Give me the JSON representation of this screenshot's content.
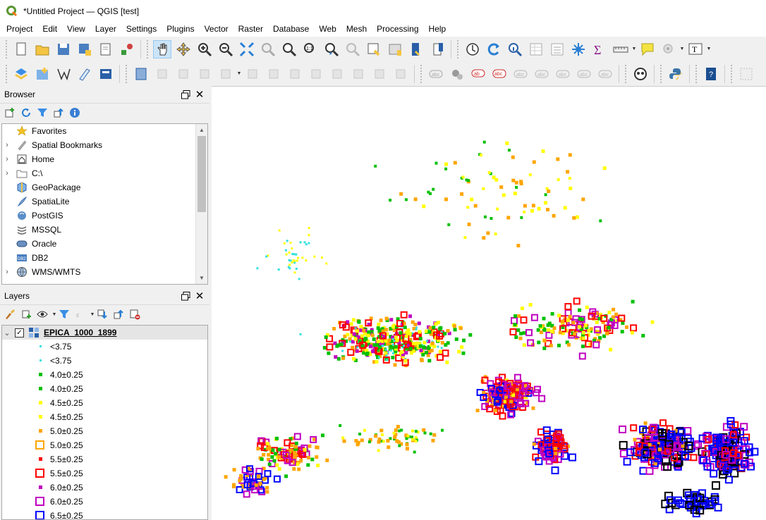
{
  "window": {
    "title": "*Untitled Project — QGIS [test]"
  },
  "menu": [
    "Project",
    "Edit",
    "View",
    "Layer",
    "Settings",
    "Plugins",
    "Vector",
    "Raster",
    "Database",
    "Web",
    "Mesh",
    "Processing",
    "Help"
  ],
  "toolbar1": [
    "new-project",
    "open-project",
    "save-project",
    "save-as",
    "print-layout",
    "style-manager",
    "pan",
    "pan-to-selection",
    "zoom-in",
    "zoom-out",
    "zoom-full",
    "zoom-to-selection",
    "zoom-to-layer",
    "zoom-native",
    "zoom-last",
    "zoom-next",
    "new-bookmark",
    "show-bookmarks",
    "temporal-controller",
    "refresh",
    "identify",
    "attribute-table",
    "field-calculator",
    "statistical-summary",
    "measure",
    "map-tips",
    "text-annotation"
  ],
  "toolbar2": [
    "data-source-manager",
    "new-geopackage-layer",
    "vertex-tool",
    "digitize",
    "save-edits",
    "add-feature",
    "label-tool",
    "pin-labels",
    "show-hide-labels",
    "python-console",
    "help"
  ],
  "browser": {
    "title": "Browser",
    "items": [
      {
        "label": "Favorites",
        "icon": "star-icon",
        "expandable": false
      },
      {
        "label": "Spatial Bookmarks",
        "icon": "bookmarks-icon",
        "expandable": true
      },
      {
        "label": "Home",
        "icon": "home-icon",
        "expandable": true
      },
      {
        "label": "C:\\",
        "icon": "folder-icon",
        "expandable": true
      },
      {
        "label": "GeoPackage",
        "icon": "geopackage-icon",
        "expandable": false
      },
      {
        "label": "SpatiaLite",
        "icon": "spatialite-icon",
        "expandable": false
      },
      {
        "label": "PostGIS",
        "icon": "postgis-icon",
        "expandable": false
      },
      {
        "label": "MSSQL",
        "icon": "mssql-icon",
        "expandable": false
      },
      {
        "label": "Oracle",
        "icon": "oracle-icon",
        "expandable": false
      },
      {
        "label": "DB2",
        "icon": "db2-icon",
        "expandable": false
      },
      {
        "label": "WMS/WMTS",
        "icon": "wms-icon",
        "expandable": true
      }
    ]
  },
  "layers": {
    "title": "Layers",
    "layer_name": "EPICA_1000_1899",
    "legend": [
      {
        "label": "<3.75",
        "color": "#33e0e0",
        "shape": "dot"
      },
      {
        "label": "<3.75",
        "color": "#33e0e0",
        "shape": "dot"
      },
      {
        "label": "4.0±0.25",
        "color": "#00c000",
        "shape": "small-square"
      },
      {
        "label": "4.0±0.25",
        "color": "#00c000",
        "shape": "small-square"
      },
      {
        "label": "4.5±0.25",
        "color": "#ffff00",
        "shape": "small-square"
      },
      {
        "label": "4.5±0.25",
        "color": "#ffff00",
        "shape": "small-square"
      },
      {
        "label": "5.0±0.25",
        "color": "#ffa500",
        "shape": "small-square"
      },
      {
        "label": "5.0±0.25",
        "color": "#ffa500",
        "shape": "hollow-square"
      },
      {
        "label": "5.5±0.25",
        "color": "#ff0000",
        "shape": "small-square"
      },
      {
        "label": "5.5±0.25",
        "color": "#ff0000",
        "shape": "hollow-square"
      },
      {
        "label": "6.0±0.25",
        "color": "#c000c0",
        "shape": "small-square"
      },
      {
        "label": "6.0±0.25",
        "color": "#c000c0",
        "shape": "hollow-square"
      },
      {
        "label": "6.5±0.25",
        "color": "#0000ff",
        "shape": "hollow-square"
      }
    ]
  }
}
